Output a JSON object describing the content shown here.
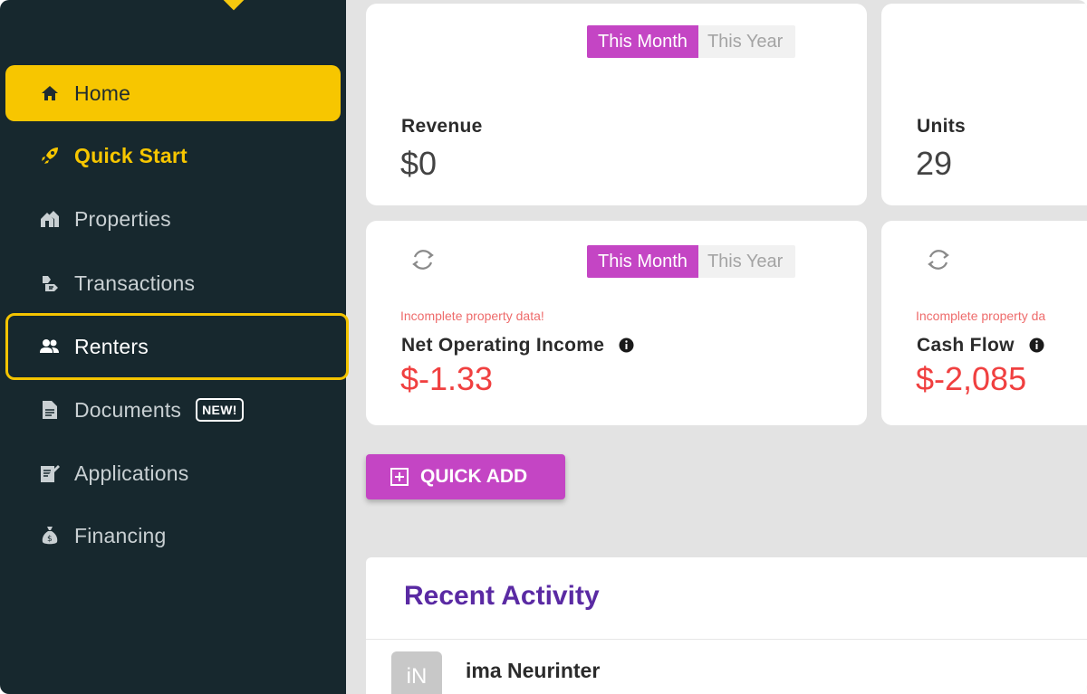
{
  "sidebar": {
    "items": [
      {
        "label": "Home",
        "icon": "home-icon"
      },
      {
        "label": "Quick Start",
        "icon": "rocket-icon"
      },
      {
        "label": "Properties",
        "icon": "properties-icon"
      },
      {
        "label": "Transactions",
        "icon": "transactions-icon"
      },
      {
        "label": "Renters",
        "icon": "users-icon"
      },
      {
        "label": "Documents",
        "icon": "document-icon",
        "badge": "NEW!"
      },
      {
        "label": "Applications",
        "icon": "applications-icon"
      },
      {
        "label": "Financing",
        "icon": "money-bag-icon"
      }
    ]
  },
  "toggle": {
    "this_month": "This Month",
    "this_year": "This Year"
  },
  "cards": {
    "revenue": {
      "label": "Revenue",
      "value": "$0"
    },
    "units": {
      "label": "Units",
      "value": "29"
    },
    "noi": {
      "warning": "Incomplete property data!",
      "label": "Net Operating Income",
      "value": "$-1.33"
    },
    "cashflow": {
      "warning": "Incomplete property da",
      "label": "Cash Flow",
      "value": "$-2,085"
    }
  },
  "quick_add": {
    "label": "QUICK ADD"
  },
  "activity": {
    "title": "Recent Activity",
    "items": [
      {
        "initials": "iN",
        "name": "ima Neurinter"
      }
    ]
  },
  "colors": {
    "sidebar": "#17282e",
    "accent_yellow": "#f7c600",
    "accent_magenta": "#c445c4",
    "negative": "#f04040",
    "heading_purple": "#5a2aa3"
  }
}
